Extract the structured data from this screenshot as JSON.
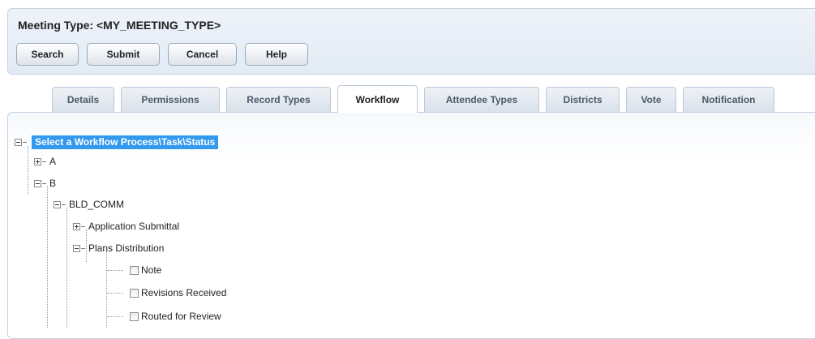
{
  "header": {
    "title": "Meeting Type: <MY_MEETING_TYPE>",
    "buttons": {
      "search": "Search",
      "submit": "Submit",
      "cancel": "Cancel",
      "help": "Help"
    }
  },
  "tabs": [
    {
      "label": "Details",
      "active": false
    },
    {
      "label": "Permissions",
      "active": false
    },
    {
      "label": "Record Types",
      "active": false
    },
    {
      "label": "Workflow",
      "active": true
    },
    {
      "label": "Attendee Types",
      "active": false
    },
    {
      "label": "Districts",
      "active": false
    },
    {
      "label": "Vote",
      "active": false
    },
    {
      "label": "Notification",
      "active": false
    }
  ],
  "tree": {
    "root": {
      "label": "Select a Workflow Process\\Task\\Status",
      "state": "expanded"
    },
    "nodes": [
      {
        "label": "A",
        "state": "collapsed"
      },
      {
        "label": "B",
        "state": "expanded"
      },
      {
        "label": "BLD_COMM",
        "state": "expanded"
      },
      {
        "label": "Application Submittal",
        "state": "collapsed"
      },
      {
        "label": "Plans Distribution",
        "state": "expanded"
      }
    ],
    "statuses": [
      {
        "label": "Note",
        "checked": false
      },
      {
        "label": "Revisions Received",
        "checked": false
      },
      {
        "label": "Routed for Review",
        "checked": false
      }
    ]
  },
  "colors": {
    "root_highlight": "#3399ee",
    "panel_background": "#e2ebf5"
  }
}
